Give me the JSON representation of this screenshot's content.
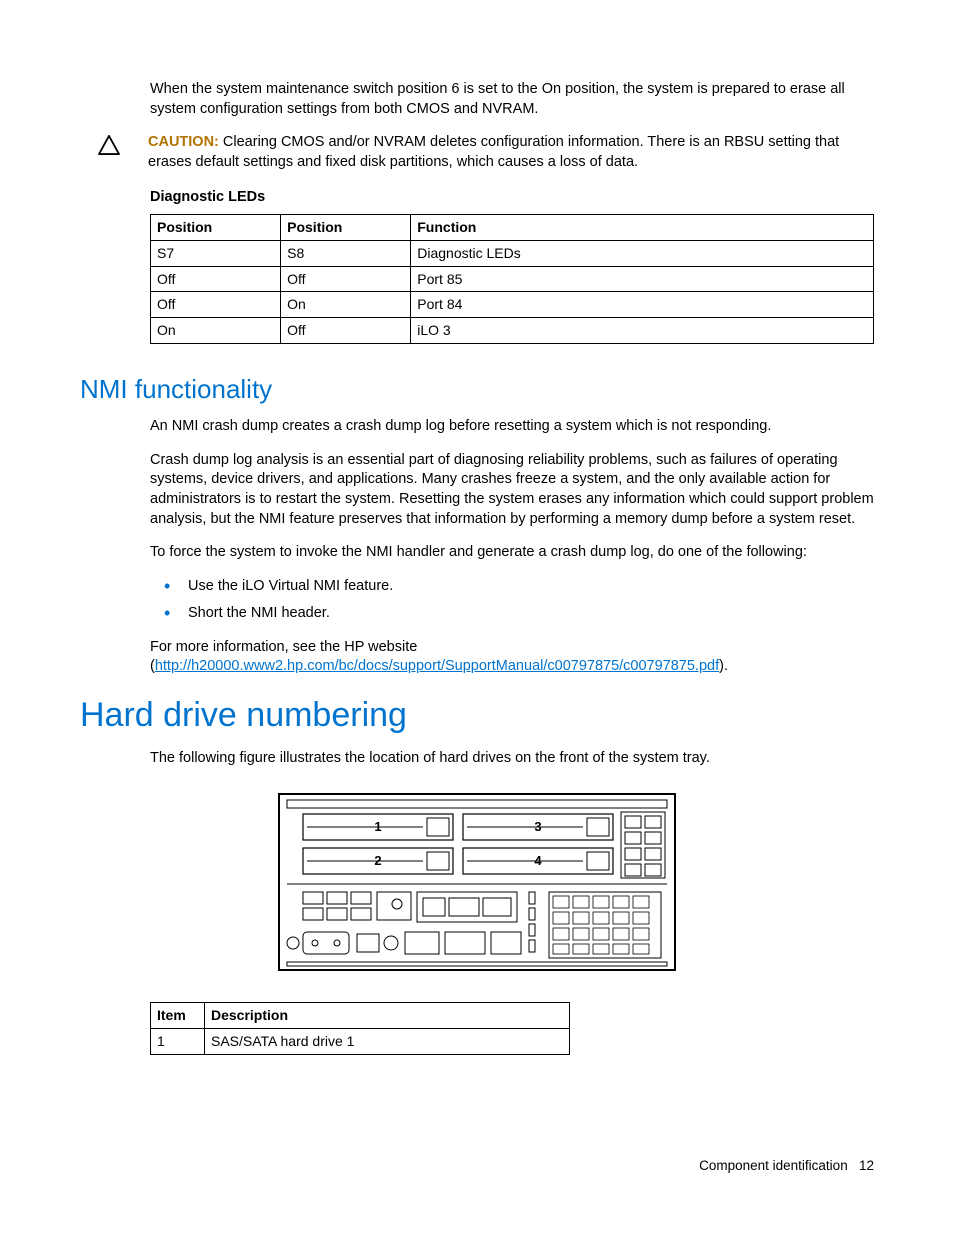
{
  "intro_para": "When the system maintenance switch position 6 is set to the On position, the system is prepared to erase all system configuration settings from both CMOS and NVRAM.",
  "caution": {
    "label": "CAUTION:",
    "text": "  Clearing CMOS and/or NVRAM deletes configuration information. There is an RBSU setting that erases default settings and fixed disk partitions, which causes a loss of data."
  },
  "diag_section_label": "Diagnostic LEDs",
  "diag_table": {
    "headers": [
      "Position",
      "Position",
      "Function"
    ],
    "rows": [
      [
        "S7",
        "S8",
        "Diagnostic LEDs"
      ],
      [
        "Off",
        "Off",
        "Port 85"
      ],
      [
        "Off",
        "On",
        "Port 84"
      ],
      [
        "On",
        "Off",
        "iLO 3"
      ]
    ]
  },
  "nmi": {
    "heading": "NMI functionality",
    "p1": "An NMI crash dump creates a crash dump log before resetting a system which is not responding.",
    "p2": "Crash dump log analysis is an essential part of diagnosing reliability problems, such as failures of operating systems, device drivers, and applications. Many crashes freeze a system, and the only available action for administrators is to restart the system. Resetting the system erases any information which could support problem analysis, but the NMI feature preserves that information by performing a memory dump before a system reset.",
    "p3": "To force the system to invoke the NMI handler and generate a crash dump log, do one of the following:",
    "bullets": [
      "Use the iLO Virtual NMI feature.",
      "Short the NMI header."
    ],
    "p4_prefix": "For more information, see the HP website (",
    "link": "http://h20000.www2.hp.com/bc/docs/support/SupportManual/c00797875/c00797875.pdf",
    "p4_suffix": ")."
  },
  "hdn": {
    "heading": "Hard drive numbering",
    "p1": "The following figure illustrates the location of hard drives on the front of the system tray.",
    "table": {
      "headers": [
        "Item",
        "Description"
      ],
      "rows": [
        [
          "1",
          "SAS/SATA hard drive 1"
        ]
      ]
    },
    "fig_labels": [
      "1",
      "2",
      "3",
      "4"
    ]
  },
  "footer": {
    "section": "Component identification",
    "page": "12"
  }
}
